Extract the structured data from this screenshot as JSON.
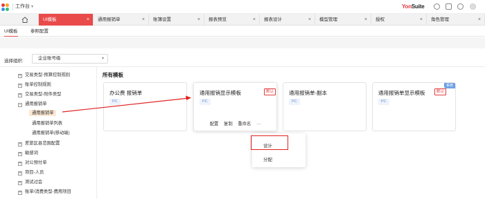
{
  "topbar": {
    "workspace_label": "工作台",
    "brand_prefix": "Yon",
    "brand_suffix": "Suite"
  },
  "tabs": [
    {
      "label": "UI模板",
      "active": true
    },
    {
      "label": "通用报销单",
      "active": false
    },
    {
      "label": "账簿设置",
      "active": false
    },
    {
      "label": "报表预览",
      "active": false
    },
    {
      "label": "报表设计",
      "active": false
    },
    {
      "label": "模型管理",
      "active": false
    },
    {
      "label": "授权",
      "active": false
    },
    {
      "label": "角色管理",
      "active": false
    }
  ],
  "subtabs": [
    {
      "label": "UI模板",
      "active": true
    },
    {
      "label": "参照配置",
      "active": false
    }
  ],
  "org": {
    "label": "选择组织:",
    "value": "企业账号级"
  },
  "tree": {
    "items": [
      {
        "label": "交易类型-预算控制规则",
        "expander": "+"
      },
      {
        "label": "账单控制规则",
        "expander": "+"
      },
      {
        "label": "交易类型-附件类型",
        "expander": "+"
      },
      {
        "label": "通用报销单",
        "expander": "−"
      },
      {
        "label": "通用报销单",
        "expander": ""
      },
      {
        "label": "通用报销单列表",
        "expander": ""
      },
      {
        "label": "通用报销单(移动端)",
        "expander": ""
      },
      {
        "label": "差旅区县范围配置",
        "expander": "+"
      },
      {
        "label": "敏感词",
        "expander": "+"
      },
      {
        "label": "对公预付单",
        "expander": "+"
      },
      {
        "label": "项目-人员",
        "expander": "+"
      },
      {
        "label": "测试过会",
        "expander": "+"
      },
      {
        "label": "账单/消费类型-费用项目",
        "expander": "+"
      }
    ]
  },
  "content": {
    "section_title": "所有模板",
    "cards": [
      {
        "name": "办公费 报销单",
        "platform": "PC",
        "default_badge": "",
        "system_badge": ""
      },
      {
        "name": "通用报销显示模板",
        "platform": "PC",
        "default_badge": "默认",
        "system_badge": ""
      },
      {
        "name": "通用报销单-副本",
        "platform": "PC",
        "default_badge": "",
        "system_badge": ""
      },
      {
        "name": "通用报销单显示模板",
        "platform": "PC",
        "default_badge": "默认",
        "system_badge": "系统"
      }
    ],
    "card_actions": {
      "configure": "配置",
      "copy": "复制",
      "rename": "重命名",
      "more": "···"
    },
    "dropdown": {
      "design": "设计",
      "assign": "分配"
    }
  },
  "colors": {
    "accent": "#e94b4b",
    "annotation_red": "#e02020",
    "tag_blue": "#6a8fce"
  }
}
